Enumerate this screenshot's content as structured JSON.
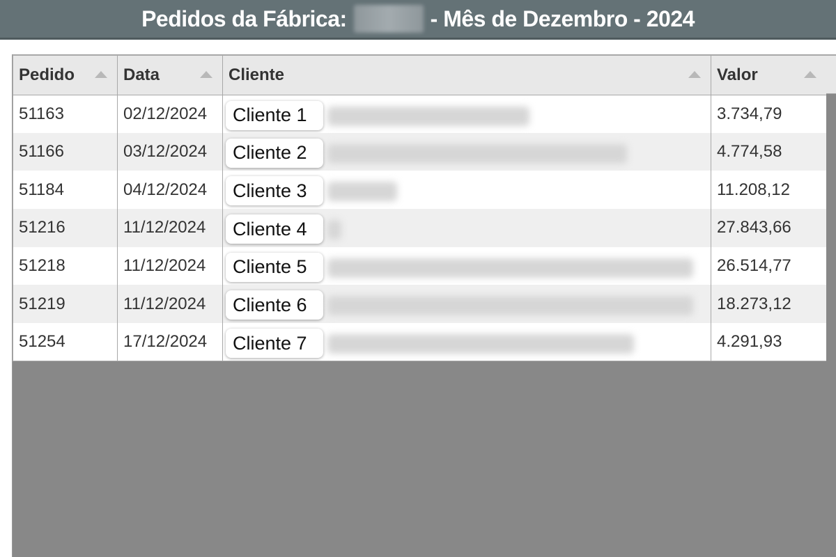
{
  "title": {
    "prefix": "Pedidos da Fábrica:",
    "suffix": "- Mês de Dezembro - 2024"
  },
  "columns": [
    {
      "label": "Pedido"
    },
    {
      "label": "Data"
    },
    {
      "label": "Cliente"
    },
    {
      "label": "Valor"
    }
  ],
  "rows": [
    {
      "pedido": "51163",
      "data": "02/12/2024",
      "cliente": "Cliente 1",
      "valor": "3.734,79"
    },
    {
      "pedido": "51166",
      "data": "03/12/2024",
      "cliente": "Cliente 2",
      "valor": "4.774,58"
    },
    {
      "pedido": "51184",
      "data": "04/12/2024",
      "cliente": "Cliente 3",
      "valor": "11.208,12"
    },
    {
      "pedido": "51216",
      "data": "11/12/2024",
      "cliente": "Cliente 4",
      "valor": "27.843,66"
    },
    {
      "pedido": "51218",
      "data": "11/12/2024",
      "cliente": "Cliente 5",
      "valor": "26.514,77"
    },
    {
      "pedido": "51219",
      "data": "11/12/2024",
      "cliente": "Cliente 6",
      "valor": "18.273,12"
    },
    {
      "pedido": "51254",
      "data": "17/12/2024",
      "cliente": "Cliente 7",
      "valor": "4.291,93"
    }
  ]
}
